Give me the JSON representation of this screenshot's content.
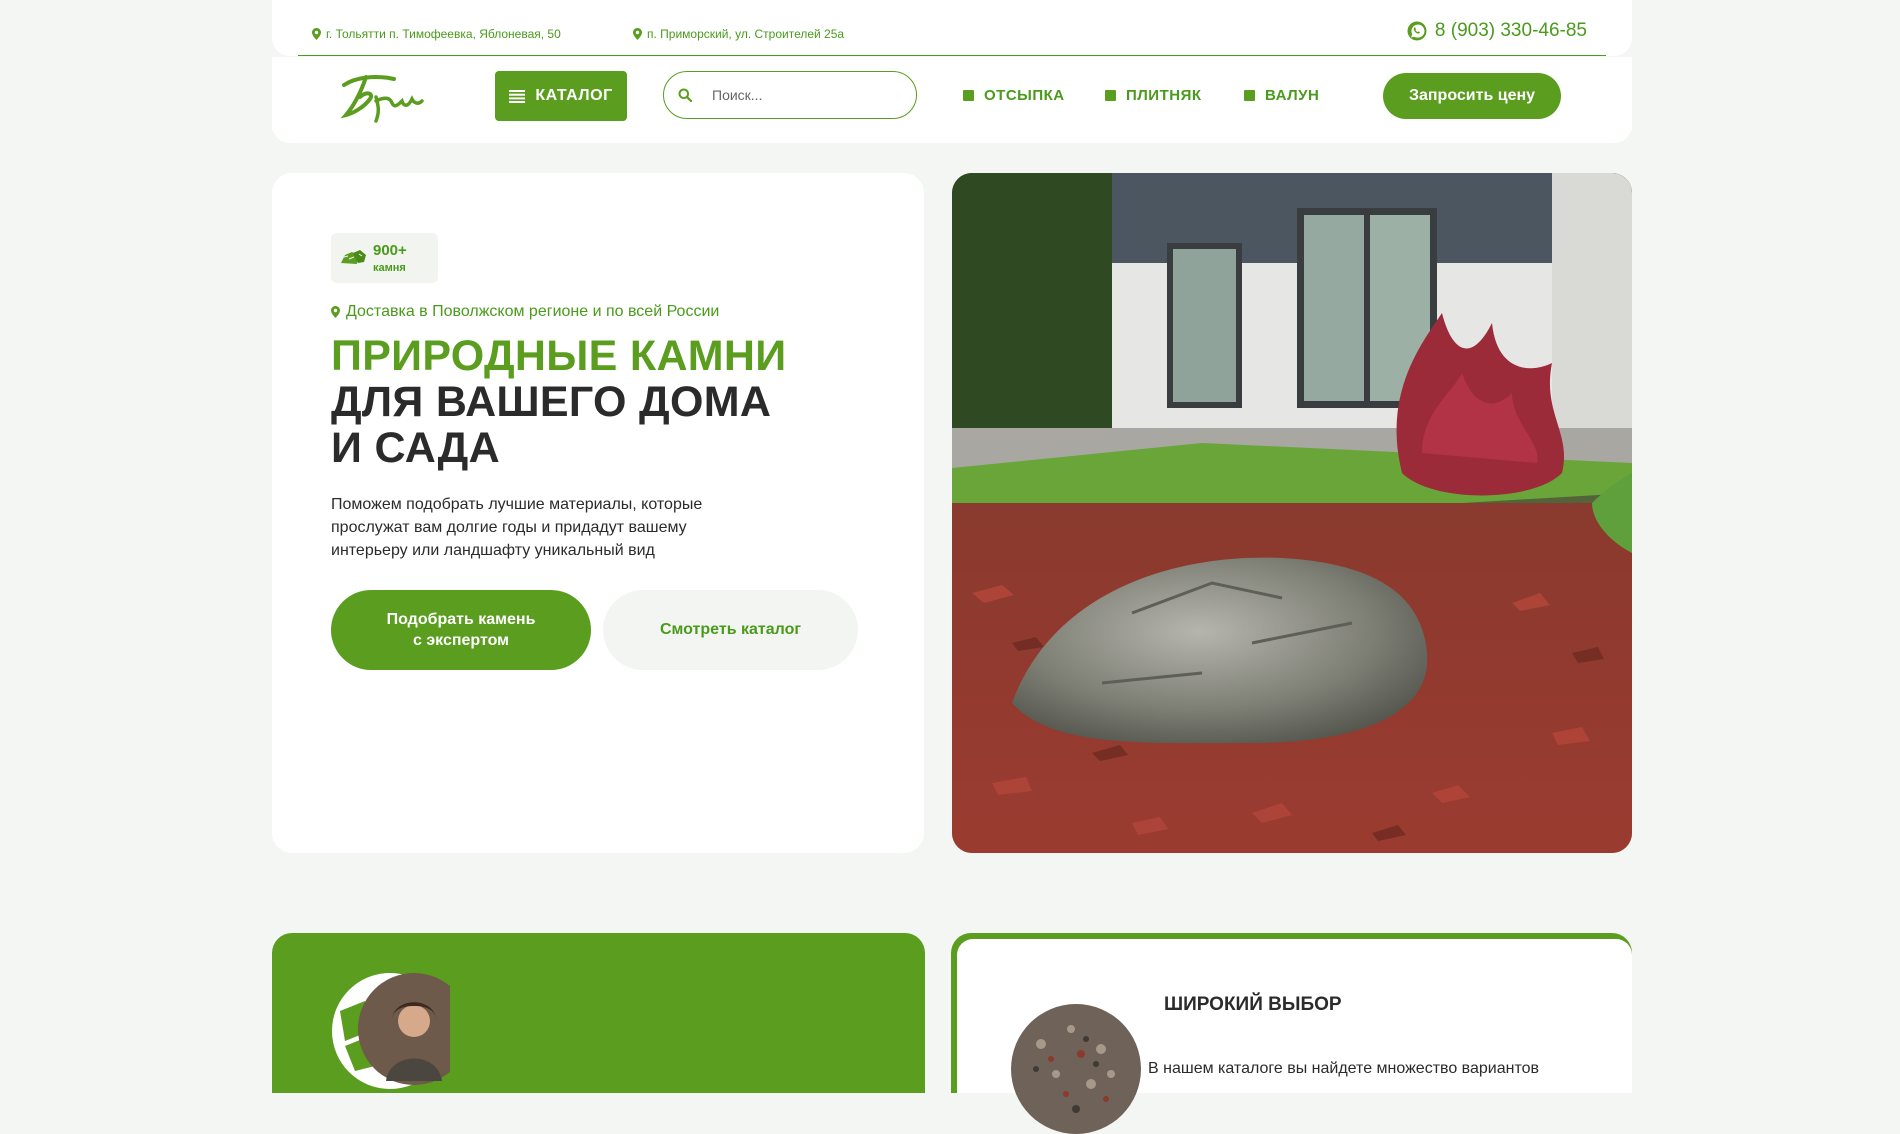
{
  "topbar": {
    "address_1": "г. Тольятти п. Тимофеевка, Яблоневая, 50",
    "address_2": "п. Приморский, ул. Строителей 25а",
    "phone": "8 (903) 330-46-85"
  },
  "header": {
    "catalog_label": "КАТАЛОГ",
    "search_placeholder": "Поиск...",
    "nav": [
      "ОТСЫПКА",
      "ПЛИТНЯК",
      "ВАЛУН"
    ],
    "price_button": "Запросить цену"
  },
  "hero": {
    "badge_count": "900+",
    "badge_unit": "камня",
    "delivery": "Доставка в Поволжском регионе и по всей России",
    "title_line1": "ПРИРОДНЫЕ КАМНИ",
    "title_line2": "ДЛЯ ВАШЕГО ДОМА",
    "title_line3": "И САДА",
    "lead": "Поможем подобрать лучшие материалы, которые прослужат вам долгие годы и придадут вашему интерьеру или ландшафту уникальный вид",
    "button_expert_line1": "Подобрать камень",
    "button_expert_line2": "с экспертом",
    "button_catalog": "Смотреть каталог"
  },
  "features": {
    "title": "ШИРОКИЙ ВЫБОР",
    "text": "В нашем каталоге вы найдете множество вариантов"
  },
  "colors": {
    "accent": "#5a9d1f",
    "text_dark": "#2b2b2b",
    "background": "#f4f6f4"
  }
}
